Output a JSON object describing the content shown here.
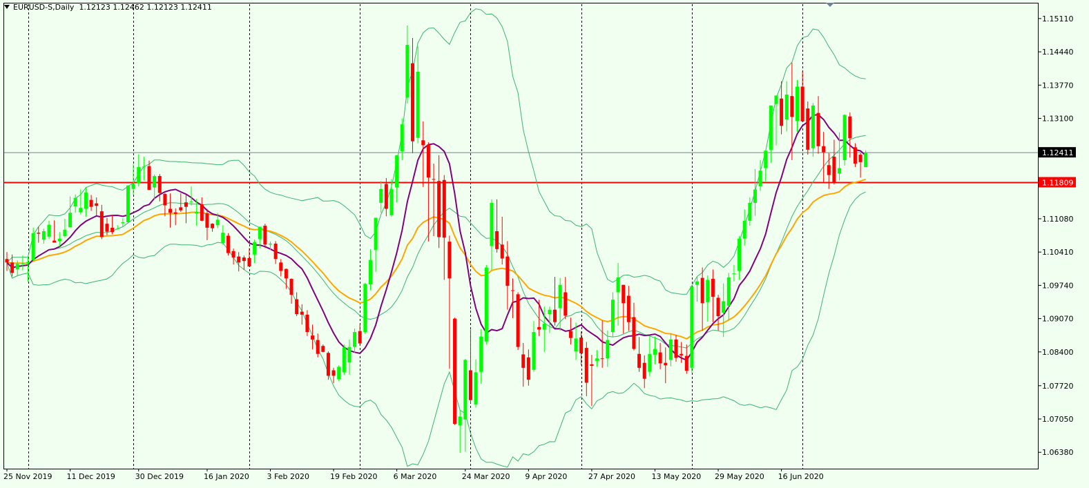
{
  "header": {
    "symbol": "EURUSD-S,Daily",
    "ohlc": "1.12123 1.12462 1.12123 1.12411"
  },
  "colors": {
    "background": "#F0FFF0",
    "bull_candle": "#00FF00",
    "bear_candle": "#FF0000",
    "bollinger": "#3CB371",
    "ma_fast": "#800080",
    "ma_slow": "#FFA500",
    "level_line": "#FF0000",
    "current_line": "#708090"
  },
  "chart_data": {
    "type": "candlestick",
    "symbol": "EURUSD-S",
    "timeframe": "Daily",
    "ylim": [
      1.0605,
      1.154
    ],
    "y_ticks": [
      "1.15110",
      "1.14440",
      "1.13770",
      "1.13100",
      "1.12411",
      "1.11809",
      "1.11080",
      "1.10410",
      "1.09740",
      "1.09070",
      "1.08400",
      "1.07720",
      "1.07050",
      "1.06380"
    ],
    "x_labels": [
      {
        "label": "25 Nov 2019",
        "index": 0
      },
      {
        "label": "11 Dec 2019",
        "index": 12
      },
      {
        "label": "30 Dec 2019",
        "index": 25
      },
      {
        "label": "16 Jan 2020",
        "index": 38
      },
      {
        "label": "3 Feb 2020",
        "index": 50
      },
      {
        "label": "19 Feb 2020",
        "index": 62
      },
      {
        "label": "6 Mar 2020",
        "index": 74
      },
      {
        "label": "24 Mar 2020",
        "index": 87
      },
      {
        "label": "9 Apr 2020",
        "index": 99
      },
      {
        "label": "27 Apr 2020",
        "index": 111
      },
      {
        "label": "13 May 2020",
        "index": 123
      },
      {
        "label": "29 May 2020",
        "index": 135
      },
      {
        "label": "16 Jun 2020",
        "index": 147
      }
    ],
    "separators": [
      4,
      24,
      46,
      67,
      88,
      109,
      130,
      151
    ],
    "current_price": {
      "label": "1.12411",
      "value": 1.12411
    },
    "level": {
      "label": "1.11809",
      "value": 1.11809
    },
    "candles": [
      [
        1.1027,
        1.1041,
        1.1003,
        1.102
      ],
      [
        1.102,
        1.1036,
        1.0992,
        1.0999
      ],
      [
        1.1006,
        1.1024,
        1.0992,
        1.1017
      ],
      [
        1.1017,
        1.1034,
        1.1004,
        1.1018
      ],
      [
        1.1018,
        1.1032,
        1.0981,
        1.1021
      ],
      [
        1.1025,
        1.109,
        1.1023,
        1.1079
      ],
      [
        1.108,
        1.1092,
        1.106,
        1.1078
      ],
      [
        1.1066,
        1.1088,
        1.1058,
        1.1083
      ],
      [
        1.1072,
        1.1104,
        1.1067,
        1.1096
      ],
      [
        1.1064,
        1.1105,
        1.106,
        1.106
      ],
      [
        1.1063,
        1.1081,
        1.1052,
        1.1068
      ],
      [
        1.1073,
        1.1108,
        1.107,
        1.1086
      ],
      [
        1.1091,
        1.1153,
        1.1091,
        1.112
      ],
      [
        1.1133,
        1.1157,
        1.112,
        1.115
      ],
      [
        1.1121,
        1.1167,
        1.1117,
        1.113
      ],
      [
        1.1128,
        1.1172,
        1.1112,
        1.1161
      ],
      [
        1.1146,
        1.1156,
        1.1124,
        1.1132
      ],
      [
        1.1139,
        1.1151,
        1.1115,
        1.1134
      ],
      [
        1.1123,
        1.1136,
        1.1067,
        1.1071
      ],
      [
        1.1098,
        1.111,
        1.1075,
        1.1082
      ],
      [
        1.109,
        1.1116,
        1.1077,
        1.1081
      ],
      [
        1.1088,
        1.1095,
        1.1088,
        1.1088
      ],
      [
        1.1099,
        1.1109,
        1.1092,
        1.1101
      ],
      [
        1.1101,
        1.1175,
        1.1101,
        1.1175
      ],
      [
        1.1168,
        1.1218,
        1.1156,
        1.1178
      ],
      [
        1.118,
        1.1238,
        1.1173,
        1.1212
      ],
      [
        1.1212,
        1.1233,
        1.1185,
        1.1213
      ],
      [
        1.1214,
        1.1225,
        1.1166,
        1.1166
      ],
      [
        1.1171,
        1.1197,
        1.1146,
        1.1194
      ],
      [
        1.1194,
        1.1198,
        1.1143,
        1.116
      ],
      [
        1.1158,
        1.116,
        1.1113,
        1.1135
      ],
      [
        1.1128,
        1.1159,
        1.109,
        1.112
      ],
      [
        1.1121,
        1.1129,
        1.1095,
        1.1118
      ],
      [
        1.1131,
        1.1159,
        1.1122,
        1.1125
      ],
      [
        1.1141,
        1.1158,
        1.1099,
        1.1132
      ],
      [
        1.1143,
        1.1173,
        1.1135,
        1.1143
      ],
      [
        1.1119,
        1.1148,
        1.1094,
        1.1122
      ],
      [
        1.1137,
        1.1151,
        1.1103,
        1.1104
      ],
      [
        1.1119,
        1.1128,
        1.1065,
        1.109
      ],
      [
        1.1098,
        1.1099,
        1.1082,
        1.1089
      ],
      [
        1.1095,
        1.112,
        1.1089,
        1.1106
      ],
      [
        1.1059,
        1.1095,
        1.1056,
        1.108
      ],
      [
        1.1074,
        1.1079,
        1.1034,
        1.1039
      ],
      [
        1.1043,
        1.1048,
        1.1016,
        1.103
      ],
      [
        1.1032,
        1.1041,
        1.1002,
        1.102
      ],
      [
        1.103,
        1.1034,
        1.1005,
        1.1023
      ],
      [
        1.1029,
        1.1049,
        1.1012,
        1.1012
      ],
      [
        1.1036,
        1.1066,
        1.1019,
        1.1061
      ],
      [
        1.1067,
        1.1092,
        1.1049,
        1.1092
      ],
      [
        1.1094,
        1.1098,
        1.1049,
        1.1056
      ],
      [
        1.1056,
        1.1062,
        1.1045,
        1.1058
      ],
      [
        1.1058,
        1.1063,
        1.1017,
        1.1027
      ],
      [
        1.102,
        1.1027,
        1.0992,
        1.1003
      ],
      [
        1.1007,
        1.1008,
        1.0967,
        1.0988
      ],
      [
        1.0987,
        1.0988,
        1.0937,
        1.0955
      ],
      [
        1.0946,
        1.096,
        1.0912,
        1.0916
      ],
      [
        1.0921,
        1.0936,
        1.0895,
        1.0915
      ],
      [
        1.0915,
        1.0924,
        1.0872,
        1.088
      ],
      [
        1.0873,
        1.0895,
        1.0845,
        1.0865
      ],
      [
        1.0864,
        1.0877,
        1.0829,
        1.0836
      ],
      [
        1.0852,
        1.0855,
        1.0839,
        1.084
      ],
      [
        1.0838,
        1.0841,
        1.0784,
        1.0792
      ],
      [
        1.0803,
        1.0808,
        1.0777,
        1.0792
      ],
      [
        1.0785,
        1.0813,
        1.0781,
        1.081
      ],
      [
        1.0799,
        1.0855,
        1.0794,
        1.0849
      ],
      [
        1.0819,
        1.0865,
        1.0794,
        1.085
      ],
      [
        1.085,
        1.0887,
        1.0838,
        1.088
      ],
      [
        1.0882,
        1.0895,
        1.0852,
        1.0857
      ],
      [
        1.088,
        1.0979,
        1.0876,
        1.0977
      ],
      [
        1.0976,
        1.1047,
        1.0964,
        1.1025
      ],
      [
        1.1045,
        1.111,
        1.1001,
        1.111
      ],
      [
        1.114,
        1.1184,
        1.112,
        1.1168
      ],
      [
        1.1178,
        1.119,
        1.1113,
        1.1128
      ],
      [
        1.1115,
        1.1188,
        1.1112,
        1.1168
      ],
      [
        1.1171,
        1.1236,
        1.1141,
        1.1236
      ],
      [
        1.1244,
        1.131,
        1.1226,
        1.1298
      ],
      [
        1.1352,
        1.1497,
        1.134,
        1.1458
      ],
      [
        1.1421,
        1.1472,
        1.124,
        1.1264
      ],
      [
        1.1271,
        1.1455,
        1.126,
        1.1404
      ],
      [
        1.1266,
        1.1304,
        1.1172,
        1.1256
      ],
      [
        1.1257,
        1.1262,
        1.1062,
        1.1191
      ],
      [
        1.1188,
        1.1219,
        1.1073,
        1.1187
      ],
      [
        1.1184,
        1.1236,
        1.1049,
        1.1071
      ],
      [
        1.1186,
        1.1196,
        1.0985,
        1.107
      ],
      [
        1.1062,
        1.1074,
        1.0806,
        1.0988
      ],
      [
        1.0907,
        1.0909,
        1.0693,
        1.0695
      ],
      [
        1.0692,
        1.0723,
        1.0637,
        1.071
      ],
      [
        1.0704,
        1.0826,
        1.0639,
        1.0824
      ],
      [
        1.0803,
        1.0885,
        1.0737,
        1.0743
      ],
      [
        1.0734,
        1.0825,
        1.0728,
        1.0799
      ],
      [
        1.08,
        1.0886,
        1.0776,
        1.0871
      ],
      [
        1.0861,
        1.1015,
        1.0855,
        1.101
      ],
      [
        1.1053,
        1.1147,
        1.1005,
        1.114
      ],
      [
        1.1083,
        1.1147,
        1.104,
        1.1047
      ],
      [
        1.1056,
        1.1112,
        1.1016,
        1.1028
      ],
      [
        1.1032,
        1.1063,
        1.0925,
        1.0973
      ],
      [
        1.0964,
        1.0988,
        1.0908,
        1.0963
      ],
      [
        1.0956,
        1.096,
        1.0844,
        1.085
      ],
      [
        1.0835,
        1.0858,
        1.077,
        1.0808
      ],
      [
        1.0829,
        1.0845,
        1.0772,
        1.0784
      ],
      [
        1.0804,
        1.0902,
        1.08,
        1.088
      ],
      [
        1.089,
        1.0945,
        1.0872,
        1.0885
      ],
      [
        1.0885,
        1.0931,
        1.084,
        1.0897
      ],
      [
        1.0916,
        1.0931,
        1.0878,
        1.0925
      ],
      [
        1.0925,
        1.0991,
        1.0893,
        1.09
      ],
      [
        1.0928,
        1.0989,
        1.0883,
        1.0975
      ],
      [
        1.096,
        1.0991,
        1.0906,
        1.0913
      ],
      [
        1.0882,
        1.0909,
        1.0855,
        1.0868
      ],
      [
        1.0841,
        1.0899,
        1.0824,
        1.0867
      ],
      [
        1.0869,
        1.0881,
        1.0813,
        1.0837
      ],
      [
        1.0848,
        1.086,
        1.0751,
        1.0778
      ],
      [
        1.0815,
        1.0834,
        1.0731,
        1.0812
      ],
      [
        1.0822,
        1.0844,
        1.081,
        1.0827
      ],
      [
        1.0827,
        1.0903,
        1.0808,
        1.0826
      ],
      [
        1.0827,
        1.0883,
        1.081,
        1.0864
      ],
      [
        1.088,
        1.096,
        1.087,
        1.0945
      ],
      [
        1.096,
        1.1019,
        1.0893,
        1.099
      ],
      [
        1.0975,
        1.0975,
        1.0877,
        1.0938
      ],
      [
        1.0953,
        1.0973,
        1.0882,
        1.09
      ],
      [
        1.091,
        1.0939,
        1.0843,
        1.0846
      ],
      [
        1.0836,
        1.087,
        1.08,
        1.0808
      ],
      [
        1.0818,
        1.0833,
        1.0767,
        1.0786
      ],
      [
        1.08,
        1.0873,
        1.0791,
        1.0836
      ],
      [
        1.0834,
        1.0871,
        1.0815,
        1.0846
      ],
      [
        1.0839,
        1.0858,
        1.0805,
        1.0817
      ],
      [
        1.0818,
        1.0849,
        1.0777,
        1.0813
      ],
      [
        1.0824,
        1.0877,
        1.0811,
        1.0865
      ],
      [
        1.0865,
        1.0874,
        1.082,
        1.0828
      ],
      [
        1.0836,
        1.086,
        1.0818,
        1.0833
      ],
      [
        1.0832,
        1.0855,
        1.0796,
        1.0802
      ],
      [
        1.0808,
        1.0972,
        1.0798,
        1.0972
      ],
      [
        1.0975,
        1.0992,
        1.0941,
        1.0982
      ],
      [
        1.0989,
        1.101,
        1.0883,
        1.0938
      ],
      [
        1.094,
        1.0994,
        1.0901,
        1.0985
      ],
      [
        1.0987,
        1.1006,
        1.09,
        1.0951
      ],
      [
        1.0949,
        1.0955,
        1.0883,
        1.0912
      ],
      [
        1.0919,
        1.0978,
        1.087,
        1.0942
      ],
      [
        1.0933,
        1.0999,
        1.0903,
        1.099
      ],
      [
        1.0997,
        1.1015,
        1.0982,
        1.0998
      ],
      [
        1.1003,
        1.1073,
        1.0985,
        1.1068
      ],
      [
        1.1068,
        1.1127,
        1.1054,
        1.1104
      ],
      [
        1.1104,
        1.1151,
        1.1094,
        1.114
      ],
      [
        1.114,
        1.1208,
        1.1114,
        1.1167
      ],
      [
        1.1173,
        1.1226,
        1.1164,
        1.1205
      ],
      [
        1.121,
        1.1246,
        1.1183,
        1.1245
      ],
      [
        1.1247,
        1.1325,
        1.122,
        1.1336
      ],
      [
        1.1339,
        1.1356,
        1.1256,
        1.1356
      ],
      [
        1.135,
        1.1385,
        1.1278,
        1.1295
      ],
      [
        1.1308,
        1.1385,
        1.1284,
        1.1358
      ],
      [
        1.1355,
        1.1422,
        1.1226,
        1.1313
      ],
      [
        1.1305,
        1.1387,
        1.1283,
        1.1374
      ],
      [
        1.1374,
        1.1405,
        1.1304,
        1.1304
      ],
      [
        1.133,
        1.1344,
        1.1237,
        1.1247
      ],
      [
        1.125,
        1.1341,
        1.1233,
        1.1336
      ],
      [
        1.1321,
        1.1355,
        1.1239,
        1.1254
      ],
      [
        1.1254,
        1.1283,
        1.1182,
        1.1242
      ],
      [
        1.1216,
        1.124,
        1.1168,
        1.1196
      ],
      [
        1.1233,
        1.1267,
        1.1177,
        1.1181
      ],
      [
        1.1199,
        1.1282,
        1.1185,
        1.121
      ],
      [
        1.1226,
        1.1318,
        1.1215,
        1.1317
      ],
      [
        1.1314,
        1.1322,
        1.1231,
        1.127
      ],
      [
        1.1252,
        1.126,
        1.1212,
        1.1219
      ],
      [
        1.1237,
        1.124,
        1.1191,
        1.1222
      ],
      [
        1.1212,
        1.1246,
        1.1212,
        1.1241
      ]
    ]
  }
}
